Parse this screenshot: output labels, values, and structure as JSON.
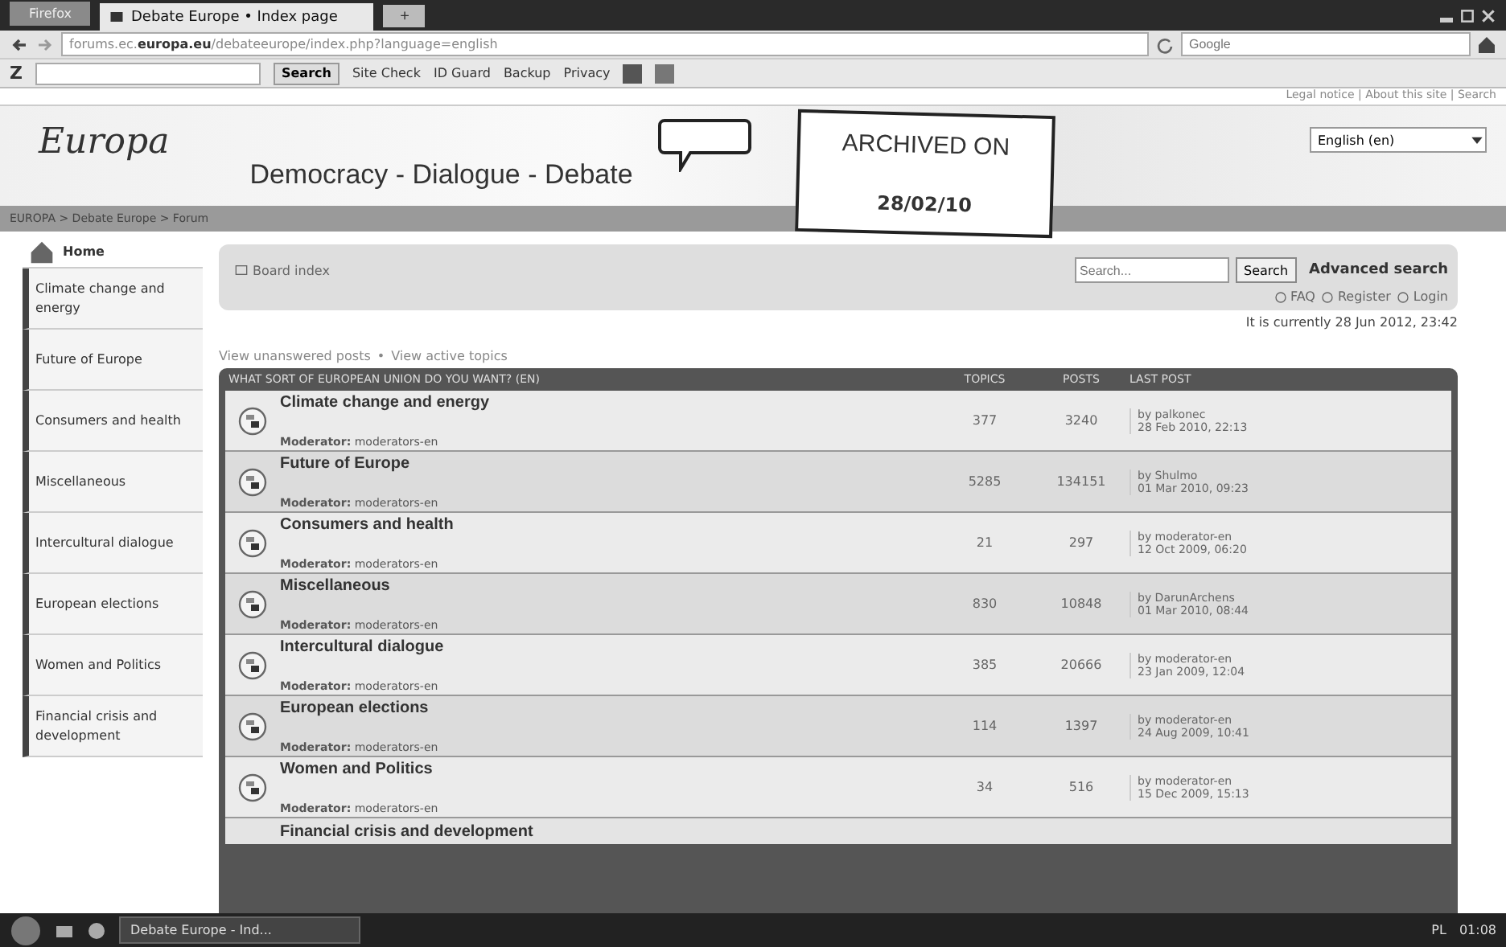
{
  "browser": {
    "app_button": "Firefox",
    "tab": "Debate Europe • Index page",
    "new_tab": "+",
    "url": "forums.ec.**europa.eu**/debateeurope/index.php?language=english",
    "search_placeholder": "Google"
  },
  "toolbar": {
    "logo": "Z",
    "search_button": "Search",
    "items": [
      "Site Check",
      "ID Guard",
      "Backup",
      "Privacy"
    ]
  },
  "top_links": "Legal notice | About this site | Search",
  "header": {
    "logo": "Europa",
    "title": "Democracy - Dialogue - Debate",
    "language": "English (en)"
  },
  "stamp": {
    "line1": "ARCHIVED ON",
    "line2": "28/02/10"
  },
  "breadcrumb": "EUROPA > Debate Europe > Forum",
  "sidebar": {
    "home": "Home",
    "items": [
      "Climate change and energy",
      "Future of Europe",
      "Consumers and health",
      "Miscellaneous",
      "Intercultural dialogue",
      "European elections",
      "Women and Politics",
      "Financial crisis and development"
    ]
  },
  "board": {
    "index": "Board index",
    "search_placeholder": "Search...",
    "search_button": "Search",
    "advanced": "Advanced search",
    "links": [
      "FAQ",
      "Register",
      "Login"
    ],
    "current_time": "It is currently 28 Jun 2012, 23:42"
  },
  "view_links": {
    "items": [
      "View unanswered posts",
      "View active topics"
    ],
    "separator": "•"
  },
  "table": {
    "columns": [
      "WHAT SORT OF EUROPEAN UNION DO YOU WANT? (EN)",
      "TOPICS",
      "POSTS",
      "LAST POST"
    ],
    "rows": [
      {
        "title": "Climate change and energy",
        "moderator_label": "Moderator:",
        "moderator": "moderators-en",
        "topics": "377",
        "posts": "3240",
        "last_by": "by palkonec",
        "last_date": "28 Feb 2010, 22:13"
      },
      {
        "title": "Future of Europe",
        "moderator_label": "Moderator:",
        "moderator": "moderators-en",
        "topics": "5285",
        "posts": "134151",
        "last_by": "by Shulmo",
        "last_date": "01 Mar 2010, 09:23"
      },
      {
        "title": "Consumers and health",
        "moderator_label": "Moderator:",
        "moderator": "moderators-en",
        "topics": "21",
        "posts": "297",
        "last_by": "by moderator-en",
        "last_date": "12 Oct 2009, 06:20"
      },
      {
        "title": "Miscellaneous",
        "moderator_label": "Moderator:",
        "moderator": "moderators-en",
        "topics": "830",
        "posts": "10848",
        "last_by": "by DarunArchens",
        "last_date": "01 Mar 2010, 08:44"
      },
      {
        "title": "Intercultural dialogue",
        "moderator_label": "Moderator:",
        "moderator": "moderators-en",
        "topics": "385",
        "posts": "20666",
        "last_by": "by moderator-en",
        "last_date": "23 Jan 2009, 12:04"
      },
      {
        "title": "European elections",
        "moderator_label": "Moderator:",
        "moderator": "moderators-en",
        "topics": "114",
        "posts": "1397",
        "last_by": "by moderator-en",
        "last_date": "24 Aug 2009, 10:41"
      },
      {
        "title": "Women and Politics",
        "moderator_label": "Moderator:",
        "moderator": "moderators-en",
        "topics": "34",
        "posts": "516",
        "last_by": "by moderator-en",
        "last_date": "15 Dec 2009, 15:13"
      },
      {
        "title": "Financial crisis and development"
      }
    ]
  },
  "taskbar": {
    "task": "Debate Europe - Ind...",
    "language": "PL",
    "clock": "01:08"
  }
}
